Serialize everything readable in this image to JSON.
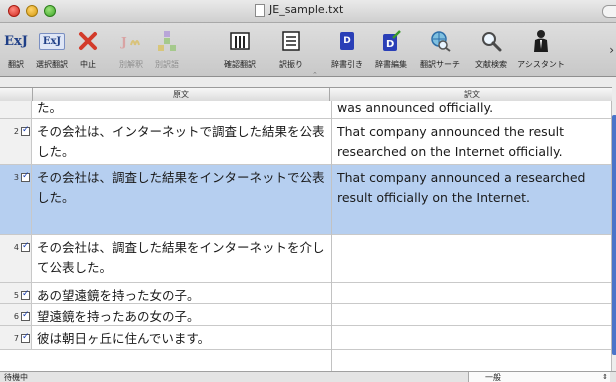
{
  "window": {
    "title": "JE_sample.txt"
  },
  "toolbar": {
    "items": [
      {
        "label": "翻訳",
        "icon": "translate-ej-icon"
      },
      {
        "label": "選択翻訳",
        "icon": "selection-translate-icon"
      },
      {
        "label": "中止",
        "icon": "stop-x-icon"
      },
      {
        "label": "別解釈",
        "icon": "alt-interpretation-icon"
      },
      {
        "label": "別訳語",
        "icon": "alt-word-icon"
      },
      {
        "label": "確認翻訳",
        "icon": "confirm-translate-icon"
      },
      {
        "label": "訳振り",
        "icon": "interlinear-icon"
      },
      {
        "label": "辞書引き",
        "icon": "dictionary-lookup-icon"
      },
      {
        "label": "辞書編集",
        "icon": "dictionary-edit-icon"
      },
      {
        "label": "翻訳サーチ",
        "icon": "translation-search-icon"
      },
      {
        "label": "文献検索",
        "icon": "document-search-icon"
      },
      {
        "label": "アシスタント",
        "icon": "assistant-icon"
      }
    ],
    "ej_text": "ExJ",
    "dict_letter": "D",
    "more": "›"
  },
  "columns": {
    "source": "原文",
    "target": "訳文"
  },
  "rows": [
    {
      "num": "",
      "source": "た。",
      "target": "was announced officially."
    },
    {
      "num": "2",
      "source": "その会社は、インターネットで調査した結果を公表した。",
      "target": "That company announced the result researched on the Internet officially."
    },
    {
      "num": "3",
      "source": "その会社は、調査した結果をインターネットで公表した。",
      "target": "That company announced a researched result officially on the Internet."
    },
    {
      "num": "4",
      "source": "その会社は、調査した結果をインターネットを介して公表した。",
      "target": ""
    },
    {
      "num": "5",
      "source": "あの望遠鏡を持った女の子。",
      "target": ""
    },
    {
      "num": "6",
      "source": "望遠鏡を持ったあの女の子。",
      "target": ""
    },
    {
      "num": "7",
      "source": "彼は朝日ヶ丘に住んでいます。",
      "target": ""
    }
  ],
  "status": {
    "text": "待機中",
    "mode": "一般"
  },
  "colors": {
    "selection": "#b6cff0",
    "accent": "#2a3fb7"
  }
}
